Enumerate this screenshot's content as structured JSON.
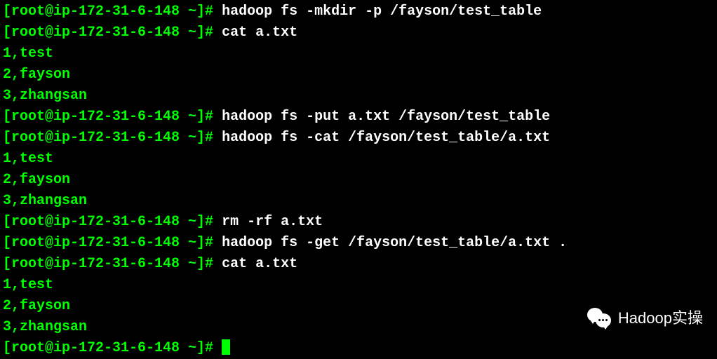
{
  "lines": [
    {
      "type": "cmd",
      "prompt": "[root@ip-172-31-6-148 ~]# ",
      "command": "hadoop fs -mkdir -p /fayson/test_table"
    },
    {
      "type": "cmd",
      "prompt": "[root@ip-172-31-6-148 ~]# ",
      "command": "cat a.txt"
    },
    {
      "type": "out",
      "text": "1,test"
    },
    {
      "type": "out",
      "text": "2,fayson"
    },
    {
      "type": "out",
      "text": "3,zhangsan"
    },
    {
      "type": "cmd",
      "prompt": "[root@ip-172-31-6-148 ~]# ",
      "command": "hadoop fs -put a.txt /fayson/test_table"
    },
    {
      "type": "cmd",
      "prompt": "[root@ip-172-31-6-148 ~]# ",
      "command": "hadoop fs -cat /fayson/test_table/a.txt"
    },
    {
      "type": "out",
      "text": "1,test"
    },
    {
      "type": "out",
      "text": "2,fayson"
    },
    {
      "type": "out",
      "text": "3,zhangsan"
    },
    {
      "type": "cmd",
      "prompt": "[root@ip-172-31-6-148 ~]# ",
      "command": "rm -rf a.txt"
    },
    {
      "type": "cmd",
      "prompt": "[root@ip-172-31-6-148 ~]# ",
      "command": "hadoop fs -get /fayson/test_table/a.txt ."
    },
    {
      "type": "cmd",
      "prompt": "[root@ip-172-31-6-148 ~]# ",
      "command": "cat a.txt"
    },
    {
      "type": "out",
      "text": "1,test"
    },
    {
      "type": "out",
      "text": "2,fayson"
    },
    {
      "type": "out",
      "text": "3,zhangsan"
    },
    {
      "type": "cursor",
      "prompt": "[root@ip-172-31-6-148 ~]# "
    }
  ],
  "watermark": {
    "text": "Hadoop实操"
  }
}
